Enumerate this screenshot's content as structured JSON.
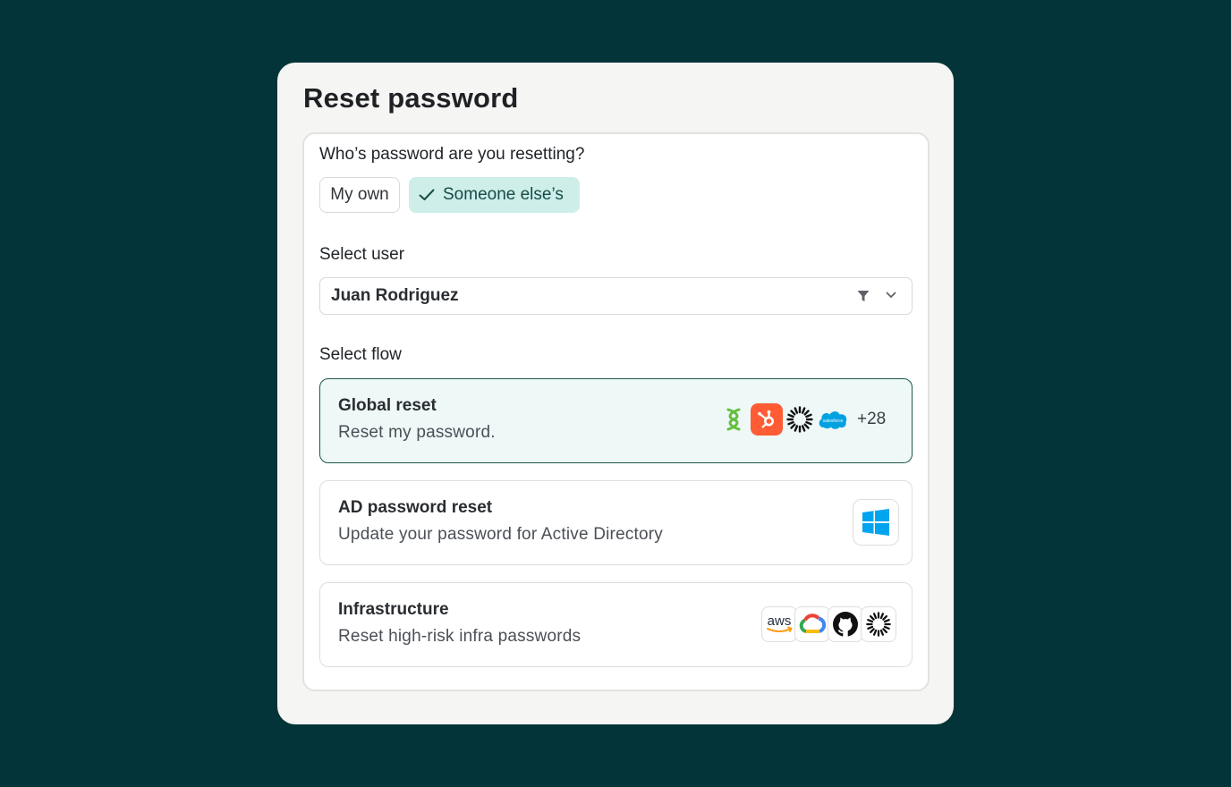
{
  "dialog": {
    "title": "Reset password"
  },
  "question": "Who’s password are you resetting?",
  "options": {
    "own": "My own",
    "someone": "Someone else’s",
    "selected": "Someone else’s"
  },
  "user_select": {
    "label": "Select user",
    "value": "Juan Rodriguez"
  },
  "flow_label": "Select flow",
  "flows": [
    {
      "title": "Global reset",
      "description": "Reset my password.",
      "icons": [
        "green-knot-icon",
        "hubspot-icon",
        "sunburst-icon",
        "salesforce-icon"
      ],
      "more": "+28",
      "selected": true
    },
    {
      "title": "AD password reset",
      "description": "Update your password for Active Directory",
      "icons": [
        "windows-icon"
      ],
      "selected": false
    },
    {
      "title": "Infrastructure",
      "description": "Reset high-risk infra passwords",
      "icons": [
        "aws-icon",
        "google-cloud-icon",
        "github-icon",
        "sunburst-icon"
      ],
      "selected": false
    }
  ],
  "logo_text": {
    "salesforce": "salesforce",
    "aws": "aws"
  },
  "colors": {
    "background": "#03343a",
    "selected_chip": "#cdeee9",
    "selected_flow_border": "#1e5650",
    "selected_flow_bg": "#edf8f7"
  }
}
